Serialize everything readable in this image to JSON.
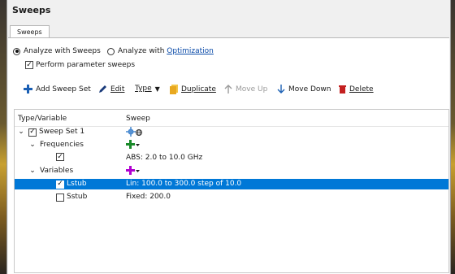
{
  "window": {
    "title": "Sweeps"
  },
  "tabs": [
    {
      "label": "Sweeps",
      "active": true
    }
  ],
  "options": {
    "analyze_sweeps": {
      "label": "Analyze with Sweeps",
      "selected": true
    },
    "analyze_optimization": {
      "label_prefix": "Analyze with ",
      "link": "Optimization",
      "selected": false
    },
    "perform_parameter_sweeps": {
      "label": "Perform parameter sweeps",
      "checked": true
    }
  },
  "toolbar": {
    "add_sweep_set": "Add Sweep Set",
    "edit": "Edit",
    "type": "Type",
    "duplicate": "Duplicate",
    "move_up": "Move Up",
    "move_down": "Move Down",
    "delete": "Delete"
  },
  "tree": {
    "columns": [
      "Type/Variable",
      "Sweep"
    ],
    "sweep_set": {
      "label": "Sweep Set 1",
      "checked": true,
      "expanded": true
    },
    "frequencies": {
      "label": "Frequencies",
      "expanded": true,
      "item": {
        "checked": true,
        "sweep": "ABS: 2.0 to 10.0 GHz"
      }
    },
    "variables": {
      "label": "Variables",
      "expanded": true,
      "items": [
        {
          "label": "Lstub",
          "checked": true,
          "sweep": "Lin: 100.0 to 300.0 step of 10.0",
          "selected": true
        },
        {
          "label": "Sstub",
          "checked": false,
          "sweep": "Fixed: 200.0",
          "selected": false
        }
      ]
    }
  },
  "colors": {
    "accent_blue": "#0078d7",
    "add_green": "#1a8a2a",
    "variable_purple": "#b000d0",
    "delete_red": "#c42020",
    "duplicate_yellow": "#e8b020"
  },
  "icons": {
    "add": "plus-icon",
    "edit": "pencil-icon",
    "duplicate": "duplicate-icon",
    "move_up": "arrow-up-icon",
    "move_down": "arrow-down-icon",
    "delete": "trash-icon",
    "sweep_set_type": "gear-globe-icon"
  }
}
